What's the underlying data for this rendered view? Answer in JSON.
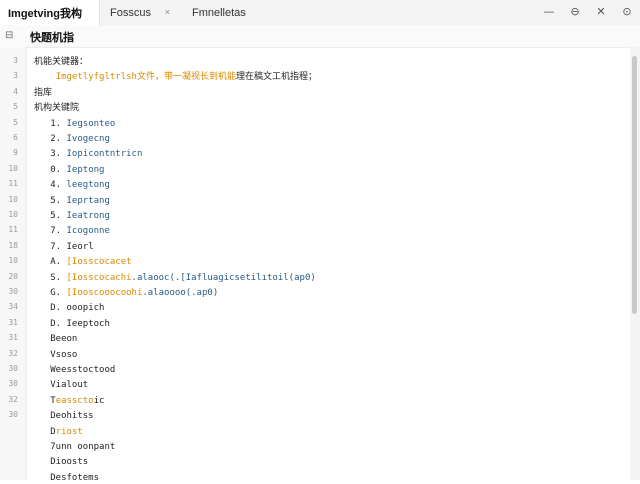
{
  "titlebar": {
    "tabs": [
      {
        "label": "Imgetving我构",
        "active": true
      },
      {
        "label": "Fosscus",
        "close": "×"
      },
      {
        "label": "Fmnelletas"
      }
    ],
    "window_controls": [
      "—",
      "⊖",
      "✕",
      "⊙"
    ]
  },
  "header": {
    "icon": "⊟",
    "title": "快题机指"
  },
  "line_numbers": [
    "3",
    "3",
    "4",
    "5",
    "5",
    "6",
    "9",
    "10",
    "11",
    "10",
    "10",
    "11",
    "18",
    "10",
    "20",
    "30",
    "34",
    "31",
    "31",
    "32",
    "30",
    "30",
    "32",
    "30"
  ],
  "lines": [
    [
      {
        "t": "机能关键器："
      }
    ],
    [
      {
        "t": "    "
      },
      {
        "t": "Imgetlyfgltrlsh",
        "c": "orange"
      },
      {
        "t": "文件，带",
        "c": "orange"
      },
      {
        "t": "一凝视长",
        "c": "orange"
      },
      {
        "t": "到机能",
        "c": "orange"
      },
      {
        "t": "理在稿文工机指程；"
      }
    ],
    [
      {
        "t": "指库"
      }
    ],
    [
      {
        "t": "机构关键院"
      }
    ],
    [
      {
        "t": "   1. "
      },
      {
        "t": "Iegsonteo",
        "c": "blue"
      }
    ],
    [
      {
        "t": "   2. "
      },
      {
        "t": "Ivogecng",
        "c": "blue"
      }
    ],
    [
      {
        "t": "   3. "
      },
      {
        "t": "Iopicontntricn",
        "c": "blue"
      }
    ],
    [
      {
        "t": "   0. "
      },
      {
        "t": "Ieptong",
        "c": "blue"
      }
    ],
    [
      {
        "t": "   4. "
      },
      {
        "t": "leegtong",
        "c": "blue"
      }
    ],
    [
      {
        "t": "   5. "
      },
      {
        "t": "Ieprtang",
        "c": "blue"
      }
    ],
    [
      {
        "t": "   5. "
      },
      {
        "t": "Ieatrong",
        "c": "blue"
      }
    ],
    [
      {
        "t": "   7. "
      },
      {
        "t": "Icogonne",
        "c": "blue"
      }
    ],
    [
      {
        "t": "   7. "
      },
      {
        "t": "Ieorl"
      }
    ],
    [
      {
        "t": "   A. "
      },
      {
        "t": "[Iosscocacet",
        "c": "orange"
      }
    ],
    [
      {
        "t": "   S. "
      },
      {
        "t": "[Iosscocachi",
        "c": "orange"
      },
      {
        "t": ".alaooc(.[Iafluagicsetilıtoil(ap0)",
        "c": "blue"
      }
    ],
    [
      {
        "t": "   G. "
      },
      {
        "t": "[Iooscooocoohi",
        "c": "orange"
      },
      {
        "t": ".alaoooo(.ap0)",
        "c": "blue"
      }
    ],
    [
      {
        "t": "   D. "
      },
      {
        "t": "ooopich"
      }
    ],
    [
      {
        "t": "   D. "
      },
      {
        "t": "Ieeptoch"
      }
    ],
    [
      {
        "t": "   Beeon"
      }
    ],
    [
      {
        "t": "   Vsoso"
      }
    ],
    [
      {
        "t": "   Weesstoctood"
      }
    ],
    [
      {
        "t": "   Vialout"
      }
    ],
    [
      {
        "t": "   T"
      },
      {
        "t": "easscto",
        "c": "orange"
      },
      {
        "t": "ic"
      }
    ],
    [
      {
        "t": "   Deohitss"
      }
    ],
    [
      {
        "t": "   D"
      },
      {
        "t": "riost",
        "c": "orange"
      }
    ],
    [
      {
        "t": "   7unn oonpant"
      }
    ],
    [
      {
        "t": "   Dioosts"
      }
    ],
    [
      {
        "t": "   Desfotems"
      }
    ]
  ]
}
